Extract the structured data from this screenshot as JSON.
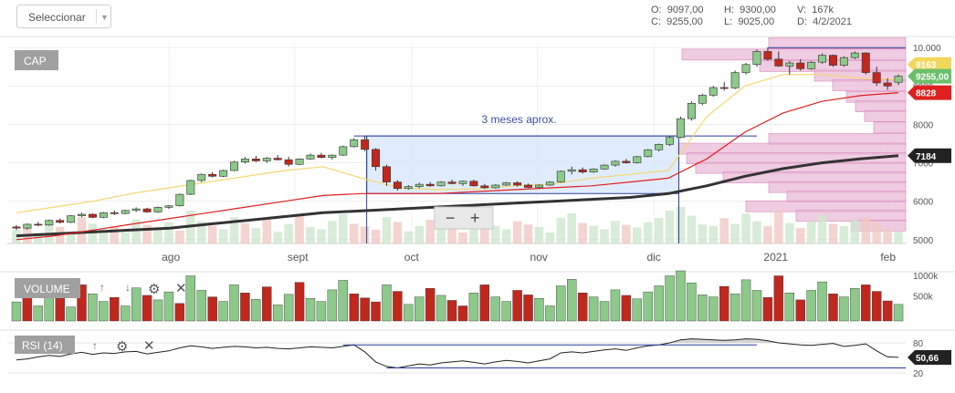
{
  "toolbar": {
    "select_label": "Seleccionar"
  },
  "ohlc": {
    "o_label": "O:",
    "o_value": "9097,00",
    "h_label": "H:",
    "h_value": "9300,00",
    "v_label": "V:",
    "v_value": "167k",
    "c_label": "C:",
    "c_value": "9255,00",
    "l_label": "L:",
    "l_value": "9025,00",
    "d_label": "D:",
    "d_value": "4/2/2021"
  },
  "panels": {
    "price": "CAP",
    "volume": "VOLUME",
    "rsi": "RSI (14)"
  },
  "annotation": "3 meses aprox.",
  "zoom": {
    "minus": "−",
    "plus": "+"
  },
  "colors": {
    "up": "#8cc98a",
    "down": "#c0281e",
    "sma_short": "#f5d76e",
    "sma_mid": "#e02020",
    "sma_long": "#333333",
    "box": "#d6e6fa",
    "profile": "#e8b6d4",
    "rsi_line": "#222222",
    "band": "#2c3e9e"
  },
  "chart_data": [
    {
      "type": "candlestick",
      "title": "CAP",
      "x_ticks": [
        "ago",
        "sept",
        "oct",
        "nov",
        "dic",
        "2021",
        "feb"
      ],
      "y_ticks": [
        "10.000",
        "9000",
        "8000",
        "7000",
        "6000",
        "5000"
      ],
      "ylim": [
        4900,
        10100
      ],
      "grid": true,
      "last_price_label": "9255,00",
      "sma_short_label": "9163",
      "sma_mid_label": "8828",
      "sma_long_label": "7184",
      "sma_short": [
        5700,
        5850,
        6000,
        6200,
        6350,
        6500,
        6650,
        6800,
        6900,
        6600,
        6350,
        6300,
        6320,
        6400,
        6450,
        6600,
        6700,
        6800,
        8200,
        9000,
        9300,
        9300,
        9200,
        9163
      ],
      "sma_mid": [
        5000,
        5100,
        5250,
        5400,
        5550,
        5700,
        5850,
        6000,
        6150,
        6200,
        6200,
        6200,
        6250,
        6300,
        6350,
        6400,
        6500,
        6600,
        7100,
        7800,
        8300,
        8600,
        8750,
        8828
      ],
      "sma_long": [
        5100,
        5150,
        5200,
        5250,
        5300,
        5400,
        5500,
        5600,
        5700,
        5750,
        5800,
        5850,
        5900,
        5950,
        6000,
        6050,
        6100,
        6200,
        6400,
        6650,
        6850,
        7000,
        7100,
        7184
      ],
      "candles": [
        [
          5330,
          5380,
          5250,
          5300
        ],
        [
          5300,
          5420,
          5260,
          5400
        ],
        [
          5400,
          5460,
          5350,
          5380
        ],
        [
          5380,
          5520,
          5360,
          5500
        ],
        [
          5500,
          5550,
          5420,
          5450
        ],
        [
          5450,
          5640,
          5430,
          5620
        ],
        [
          5620,
          5700,
          5580,
          5660
        ],
        [
          5660,
          5680,
          5560,
          5580
        ],
        [
          5580,
          5720,
          5560,
          5700
        ],
        [
          5700,
          5760,
          5640,
          5680
        ],
        [
          5680,
          5780,
          5660,
          5760
        ],
        [
          5760,
          5840,
          5720,
          5800
        ],
        [
          5800,
          5830,
          5700,
          5720
        ],
        [
          5720,
          5860,
          5700,
          5840
        ],
        [
          5840,
          5900,
          5800,
          5880
        ],
        [
          5880,
          6200,
          5860,
          6180
        ],
        [
          6180,
          6560,
          6160,
          6540
        ],
        [
          6540,
          6720,
          6500,
          6700
        ],
        [
          6700,
          6760,
          6620,
          6650
        ],
        [
          6650,
          6820,
          6630,
          6800
        ],
        [
          6800,
          7050,
          6780,
          7020
        ],
        [
          7020,
          7150,
          6980,
          7100
        ],
        [
          7100,
          7180,
          7020,
          7050
        ],
        [
          7050,
          7150,
          7000,
          7120
        ],
        [
          7120,
          7200,
          7060,
          7080
        ],
        [
          7080,
          7160,
          6900,
          6960
        ],
        [
          6960,
          7120,
          6940,
          7100
        ],
        [
          7100,
          7240,
          7080,
          7200
        ],
        [
          7200,
          7260,
          7120,
          7140
        ],
        [
          7140,
          7220,
          7080,
          7200
        ],
        [
          7200,
          7450,
          7180,
          7420
        ],
        [
          7420,
          7640,
          7400,
          7600
        ],
        [
          7600,
          7700,
          7300,
          7350
        ],
        [
          7350,
          7380,
          6800,
          6900
        ],
        [
          6900,
          6950,
          6400,
          6500
        ],
        [
          6500,
          6550,
          6280,
          6330
        ],
        [
          6330,
          6420,
          6300,
          6380
        ],
        [
          6380,
          6480,
          6340,
          6440
        ],
        [
          6440,
          6500,
          6380,
          6400
        ],
        [
          6400,
          6520,
          6380,
          6500
        ],
        [
          6500,
          6560,
          6440,
          6460
        ],
        [
          6460,
          6540,
          6400,
          6520
        ],
        [
          6520,
          6560,
          6380,
          6400
        ],
        [
          6400,
          6450,
          6320,
          6350
        ],
        [
          6350,
          6440,
          6330,
          6420
        ],
        [
          6420,
          6500,
          6400,
          6480
        ],
        [
          6480,
          6520,
          6380,
          6420
        ],
        [
          6420,
          6460,
          6340,
          6360
        ],
        [
          6360,
          6440,
          6340,
          6420
        ],
        [
          6420,
          6520,
          6400,
          6500
        ],
        [
          6500,
          6800,
          6480,
          6780
        ],
        [
          6780,
          6900,
          6700,
          6820
        ],
        [
          6820,
          6880,
          6720,
          6760
        ],
        [
          6760,
          6860,
          6740,
          6840
        ],
        [
          6840,
          6960,
          6820,
          6940
        ],
        [
          6940,
          7060,
          6900,
          7040
        ],
        [
          7040,
          7100,
          6980,
          7000
        ],
        [
          7000,
          7180,
          6980,
          7160
        ],
        [
          7160,
          7360,
          7140,
          7340
        ],
        [
          7340,
          7500,
          7300,
          7480
        ],
        [
          7480,
          7700,
          7440,
          7660
        ],
        [
          7660,
          8200,
          7640,
          8150
        ],
        [
          8150,
          8600,
          8100,
          8550
        ],
        [
          8550,
          8800,
          8500,
          8760
        ],
        [
          8760,
          9000,
          8720,
          8960
        ],
        [
          8960,
          9100,
          8880,
          8950
        ],
        [
          8950,
          9400,
          8920,
          9350
        ],
        [
          9350,
          9600,
          9300,
          9560
        ],
        [
          9560,
          9950,
          9500,
          9900
        ],
        [
          9900,
          10000,
          9650,
          9700
        ],
        [
          9700,
          9900,
          9500,
          9520
        ],
        [
          9520,
          9650,
          9300,
          9600
        ],
        [
          9600,
          9700,
          9400,
          9450
        ],
        [
          9450,
          9650,
          9420,
          9620
        ],
        [
          9620,
          9850,
          9580,
          9800
        ],
        [
          9800,
          9820,
          9500,
          9540
        ],
        [
          9540,
          9780,
          9500,
          9740
        ],
        [
          9740,
          9900,
          9700,
          9860
        ],
        [
          9860,
          9880,
          9300,
          9350
        ],
        [
          9350,
          9500,
          9000,
          9080
        ],
        [
          9080,
          9200,
          8900,
          9000
        ],
        [
          9097,
          9300,
          9025,
          9255
        ]
      ]
    },
    {
      "type": "bar",
      "title": "VOLUME",
      "y_ticks": [
        "1000k",
        "500k"
      ],
      "values": [
        380,
        520,
        300,
        610,
        450,
        280,
        720,
        540,
        390,
        470,
        300,
        660,
        510,
        420,
        580,
        350,
        900,
        610,
        480,
        390,
        720,
        560,
        430,
        680,
        320,
        530,
        770,
        450,
        390,
        620,
        810,
        540,
        460,
        380,
        720,
        590,
        330,
        480,
        650,
        510,
        410,
        300,
        560,
        720,
        480,
        390,
        610,
        520,
        450,
        300,
        700,
        830,
        560,
        480,
        390,
        620,
        510,
        440,
        580,
        700,
        900,
        1000,
        760,
        520,
        480,
        690,
        540,
        820,
        610,
        470,
        900,
        560,
        420,
        610,
        780,
        540,
        480,
        650,
        720,
        590,
        400,
        330
      ],
      "up": [
        1,
        0,
        1,
        1,
        0,
        1,
        0,
        1,
        1,
        0,
        1,
        1,
        0,
        1,
        1,
        0,
        1,
        1,
        0,
        1,
        1,
        0,
        1,
        0,
        1,
        1,
        0,
        1,
        1,
        1,
        1,
        0,
        0,
        0,
        1,
        0,
        1,
        1,
        0,
        1,
        0,
        0,
        1,
        0,
        1,
        1,
        0,
        0,
        1,
        1,
        1,
        1,
        0,
        1,
        1,
        1,
        0,
        1,
        1,
        1,
        1,
        1,
        1,
        1,
        1,
        0,
        1,
        1,
        1,
        0,
        0,
        1,
        0,
        1,
        1,
        0,
        1,
        1,
        0,
        0,
        0,
        1
      ]
    },
    {
      "type": "line",
      "title": "RSI (14)",
      "y_ticks": [
        "80",
        "20"
      ],
      "last_value": "50,66",
      "values": [
        46,
        48,
        52,
        55,
        53,
        58,
        61,
        57,
        60,
        59,
        62,
        63,
        58,
        61,
        64,
        70,
        74,
        72,
        69,
        71,
        73,
        72,
        70,
        71,
        69,
        68,
        70,
        72,
        71,
        70,
        73,
        76,
        62,
        42,
        33,
        30,
        34,
        38,
        36,
        40,
        42,
        44,
        41,
        38,
        42,
        45,
        43,
        40,
        44,
        48,
        60,
        62,
        60,
        63,
        66,
        68,
        65,
        70,
        74,
        76,
        80,
        86,
        88,
        87,
        86,
        85,
        86,
        88,
        87,
        84,
        80,
        78,
        76,
        75,
        77,
        79,
        73,
        75,
        78,
        64,
        52,
        51
      ]
    }
  ]
}
